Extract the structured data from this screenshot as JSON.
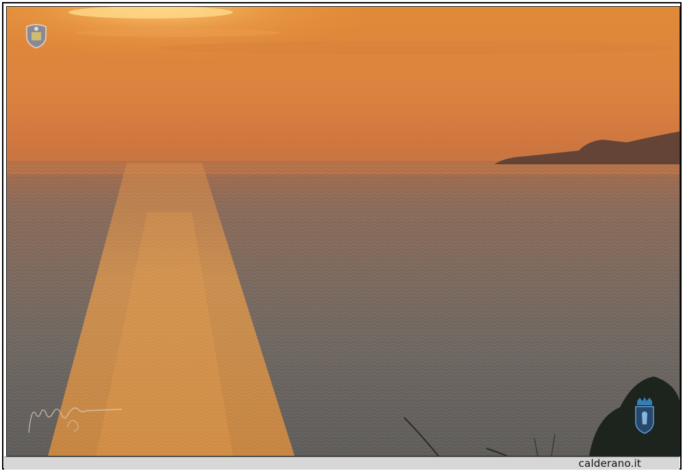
{
  "footer": {
    "site": "calderano.it"
  },
  "watermarks": {
    "top_left": "crest-icon",
    "bottom_right": "crest-icon",
    "signature": "signature-icon"
  },
  "colors": {
    "sky_top": "#e08a3a",
    "sky_horizon": "#c8713c",
    "sea": "#6e6660",
    "sun_glow": "#f7c25a",
    "footer_bg": "#d7d7d7"
  }
}
